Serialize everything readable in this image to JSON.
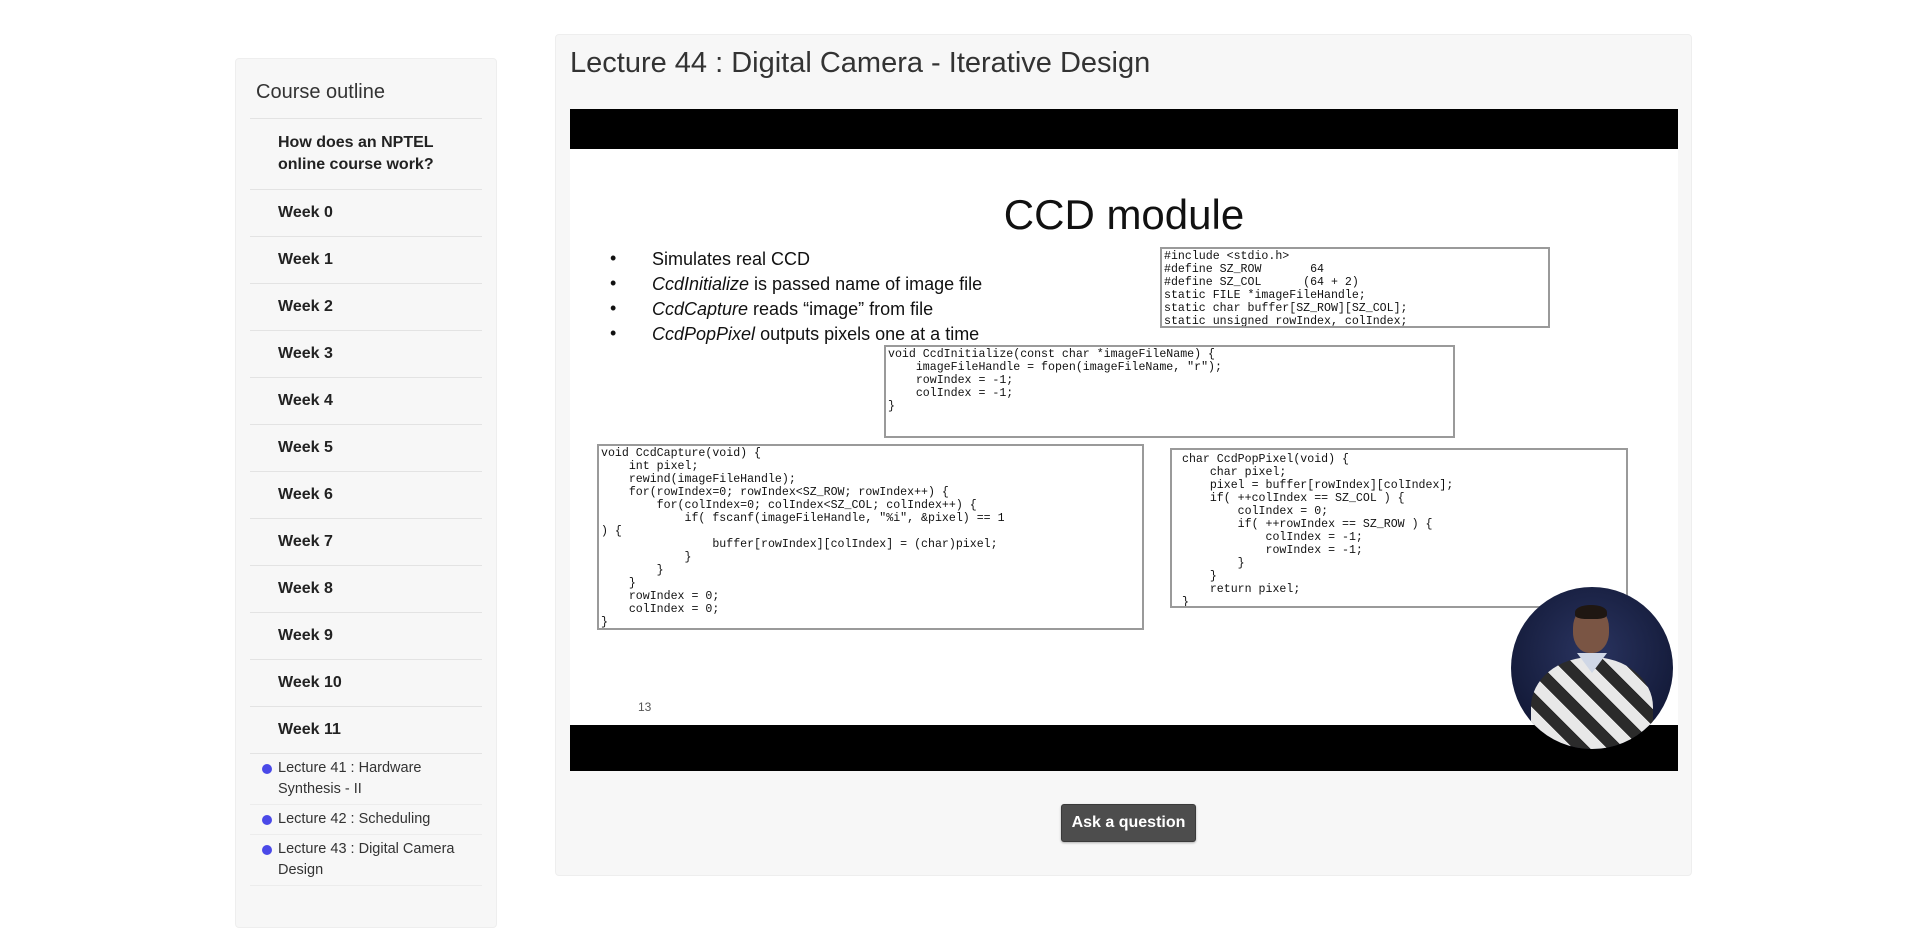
{
  "sidebar": {
    "title": "Course outline",
    "items": [
      {
        "label": "How does an NPTEL online course work?"
      },
      {
        "label": "Week 0"
      },
      {
        "label": "Week 1"
      },
      {
        "label": "Week 2"
      },
      {
        "label": "Week 3"
      },
      {
        "label": "Week 4"
      },
      {
        "label": "Week 5"
      },
      {
        "label": "Week 6"
      },
      {
        "label": "Week 7"
      },
      {
        "label": "Week 8"
      },
      {
        "label": "Week 9"
      },
      {
        "label": "Week 10"
      },
      {
        "label": "Week 11"
      }
    ],
    "lectures": [
      {
        "label": "Lecture 41 : Hardware Synthesis - II"
      },
      {
        "label": "Lecture 42 : Scheduling"
      },
      {
        "label": "Lecture 43 : Digital Camera Design"
      }
    ],
    "dot_color": "#4a49e8"
  },
  "main": {
    "title": "Lecture 44 : Digital Camera - Iterative Design",
    "ask_button_label": "Ask a question"
  },
  "video": {
    "slide_title": "CCD module",
    "bullets": [
      {
        "em": "",
        "text": "Simulates real CCD"
      },
      {
        "em": "CcdInitialize",
        "text": " is passed name of image file"
      },
      {
        "em": "CcdCapture",
        "text": " reads “image” from file"
      },
      {
        "em": "CcdPopPixel",
        "text": " outputs pixels one at a time"
      }
    ],
    "code_header": "#include <stdio.h>\n#define SZ_ROW       64\n#define SZ_COL      (64 + 2)\nstatic FILE *imageFileHandle;\nstatic char buffer[SZ_ROW][SZ_COL];\nstatic unsigned rowIndex, colIndex;",
    "code_init": "void CcdInitialize(const char *imageFileName) {\n    imageFileHandle = fopen(imageFileName, \"r\");\n    rowIndex = -1;\n    colIndex = -1;\n}",
    "code_capture": "void CcdCapture(void) {\n    int pixel;\n    rewind(imageFileHandle);\n    for(rowIndex=0; rowIndex<SZ_ROW; rowIndex++) {\n        for(colIndex=0; colIndex<SZ_COL; colIndex++) {\n            if( fscanf(imageFileHandle, \"%i\", &pixel) == 1\n) {\n                buffer[rowIndex][colIndex] = (char)pixel;\n            }\n        }\n    }\n    rowIndex = 0;\n    colIndex = 0;\n}",
    "code_pop": "char CcdPopPixel(void) {\n    char pixel;\n    pixel = buffer[rowIndex][colIndex];\n    if( ++colIndex == SZ_COL ) {\n        colIndex = 0;\n        if( ++rowIndex == SZ_ROW ) {\n            colIndex = -1;\n            rowIndex = -1;\n        }\n    }\n    return pixel;\n}",
    "slide_number": "13"
  }
}
